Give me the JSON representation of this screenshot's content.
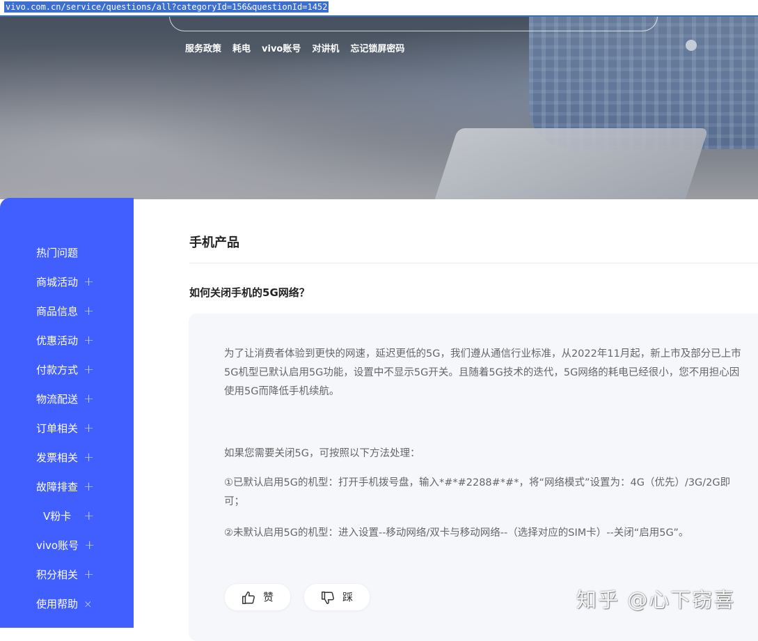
{
  "address_bar": {
    "url": "vivo.com.cn/service/questions/all?categoryId=156&questionId=1452"
  },
  "hero": {
    "hot_links": [
      "服务政策",
      "耗电",
      "vivo账号",
      "对讲机",
      "忘记锁屏密码"
    ]
  },
  "sidebar": {
    "items": [
      {
        "label": "热门问题",
        "toggle": ""
      },
      {
        "label": "商城活动",
        "toggle": "+"
      },
      {
        "label": "商品信息",
        "toggle": "+"
      },
      {
        "label": "优惠活动",
        "toggle": "+"
      },
      {
        "label": "付款方式",
        "toggle": "+"
      },
      {
        "label": "物流配送",
        "toggle": "+"
      },
      {
        "label": "订单相关",
        "toggle": "+"
      },
      {
        "label": "发票相关",
        "toggle": "+"
      },
      {
        "label": "故障排查",
        "toggle": "+"
      },
      {
        "label": "V粉卡",
        "toggle": "+"
      },
      {
        "label": "vivo账号",
        "toggle": "+"
      },
      {
        "label": "积分相关",
        "toggle": "+"
      },
      {
        "label": "使用帮助",
        "toggle": "×"
      }
    ]
  },
  "main": {
    "category_title": "手机产品",
    "question_title": "如何关闭手机的5G网络？",
    "answer": {
      "paragraph_1": "为了让消费者体验到更快的网速，延迟更低的5G，我们遵从通信行业标准，从2022年11月起，新上市及部分已上市5G机型已默认启用5G功能，设置中不显示5G开关。且随着5G技术的迭代，5G网络的耗电已经很小，您不用担心因使用5G而降低手机续航。",
      "paragraph_2": "如果您需要关闭5G，可按照以下方法处理：",
      "paragraph_3": "①已默认启用5G的机型：打开手机拨号盘，输入*#*#2288#*#*，将“网络模式”设置为：4G（优先）/3G/2G即可；",
      "paragraph_4": "②未默认启用5G的机型：进入设置--移动网络/双卡与移动网络--（选择对应的SIM卡）--关闭“启用5G”。"
    },
    "vote": {
      "like_label": "赞",
      "dislike_label": "踩"
    }
  },
  "watermark": "知乎 @心下窃喜",
  "colors": {
    "sidebar": "#415fff",
    "card": "#f5f7fa",
    "url_highlight": "#3d6fd0"
  }
}
